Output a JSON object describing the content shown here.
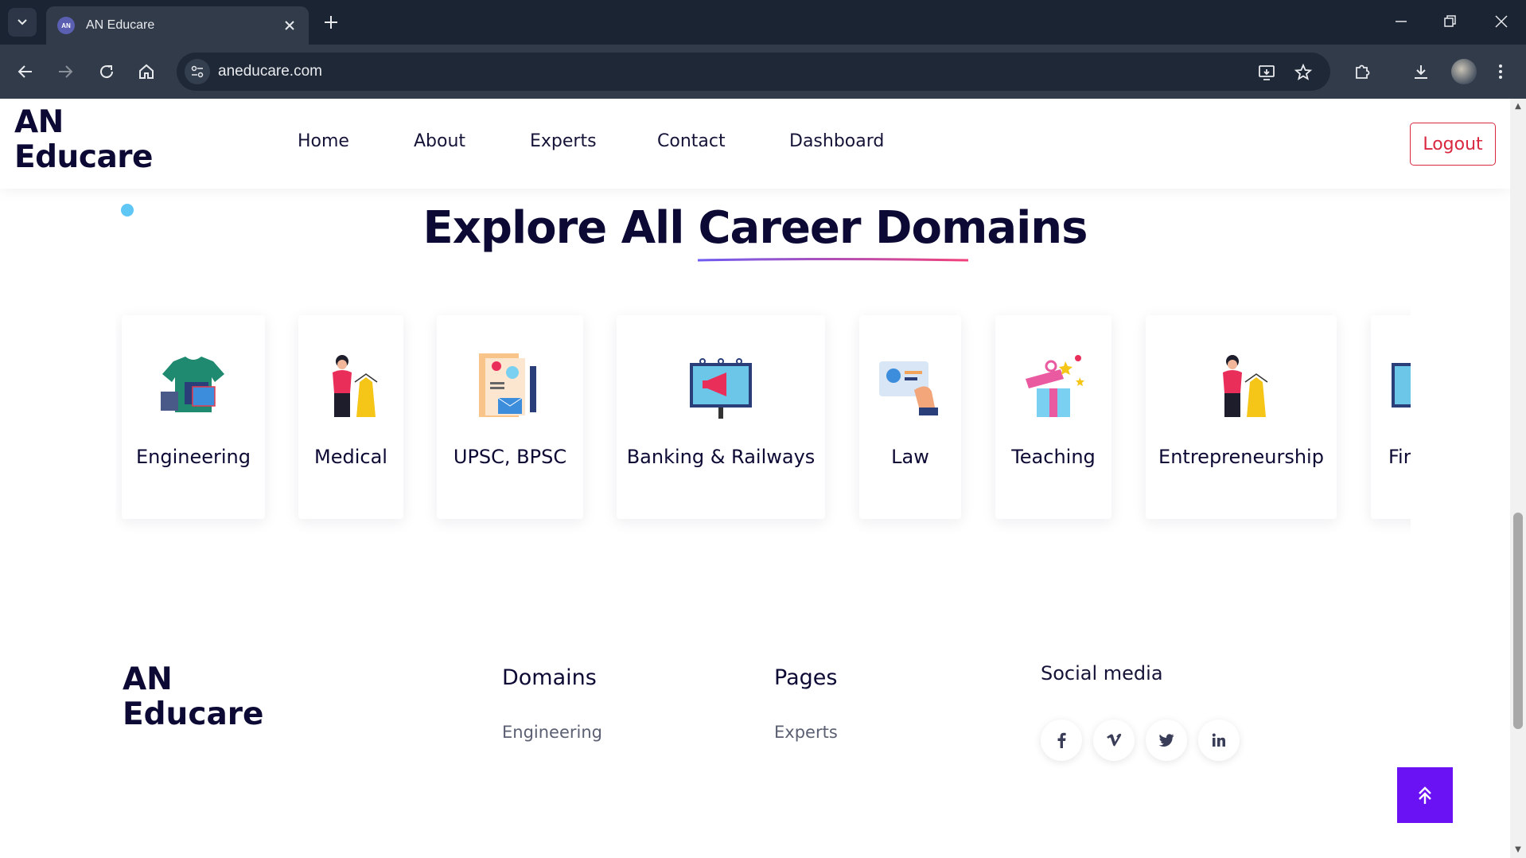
{
  "browser": {
    "tab_title": "AN Educare",
    "tab_favicon_text": "AN",
    "url": "aneducare.com"
  },
  "header": {
    "logo_line1": "AN",
    "logo_line2": "Educare",
    "nav": [
      "Home",
      "About",
      "Experts",
      "Contact",
      "Dashboard"
    ],
    "logout_label": "Logout"
  },
  "section": {
    "title_plain": "Explore All",
    "title_accent": "Career Domains"
  },
  "domains": [
    {
      "label": "Engineering",
      "icon": "tshirt-design-icon"
    },
    {
      "label": "Medical",
      "icon": "person-with-dress-icon"
    },
    {
      "label": "UPSC, BPSC",
      "icon": "documents-lightbulb-icon"
    },
    {
      "label": "Banking & Railways",
      "icon": "billboard-megaphone-icon"
    },
    {
      "label": "Law",
      "icon": "id-card-hand-icon"
    },
    {
      "label": "Teaching",
      "icon": "gift-box-icon"
    },
    {
      "label": "Entrepreneurship",
      "icon": "person-with-dress-icon"
    },
    {
      "label": "Fir",
      "icon": "billboard-icon"
    }
  ],
  "footer": {
    "logo_line1": "AN",
    "logo_line2": "Educare",
    "domains_heading": "Domains",
    "domains_first_link": "Engineering",
    "pages_heading": "Pages",
    "pages_first_link": "Experts",
    "social_heading": "Social media",
    "social": [
      "facebook-icon",
      "vimeo-icon",
      "twitter-icon",
      "linkedin-icon"
    ]
  },
  "colors": {
    "brand_dark": "#0c0a34",
    "logout_red": "#d9283f",
    "scroll_top_purple": "#6b12f5",
    "chrome_dark": "#1b2433"
  }
}
